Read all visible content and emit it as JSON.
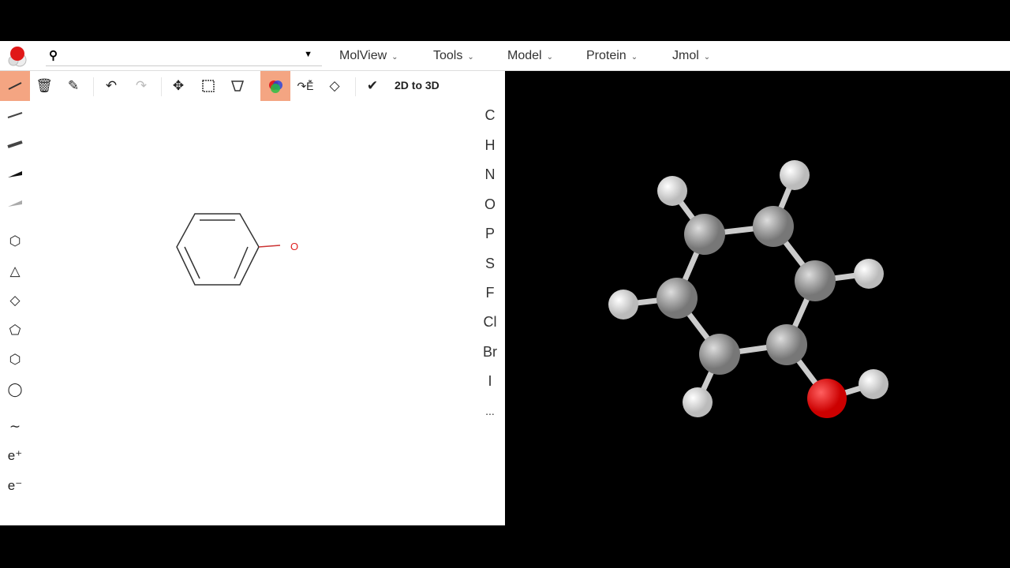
{
  "header": {
    "search_placeholder": "",
    "menus": [
      {
        "label": "MolView"
      },
      {
        "label": "Tools"
      },
      {
        "label": "Model"
      },
      {
        "label": "Protein"
      },
      {
        "label": "Jmol"
      }
    ]
  },
  "toolbar": {
    "convert_label": "2D to 3D"
  },
  "left_tools": {
    "wave": "∼",
    "e_plus": "e⁺",
    "e_minus": "e⁻"
  },
  "elements": [
    "C",
    "H",
    "N",
    "O",
    "P",
    "S",
    "F",
    "Cl",
    "Br",
    "I",
    "..."
  ],
  "sketch": {
    "oxygen_label": "O"
  },
  "colors": {
    "accent": "#f4a582",
    "oxygen": "#e02020"
  }
}
